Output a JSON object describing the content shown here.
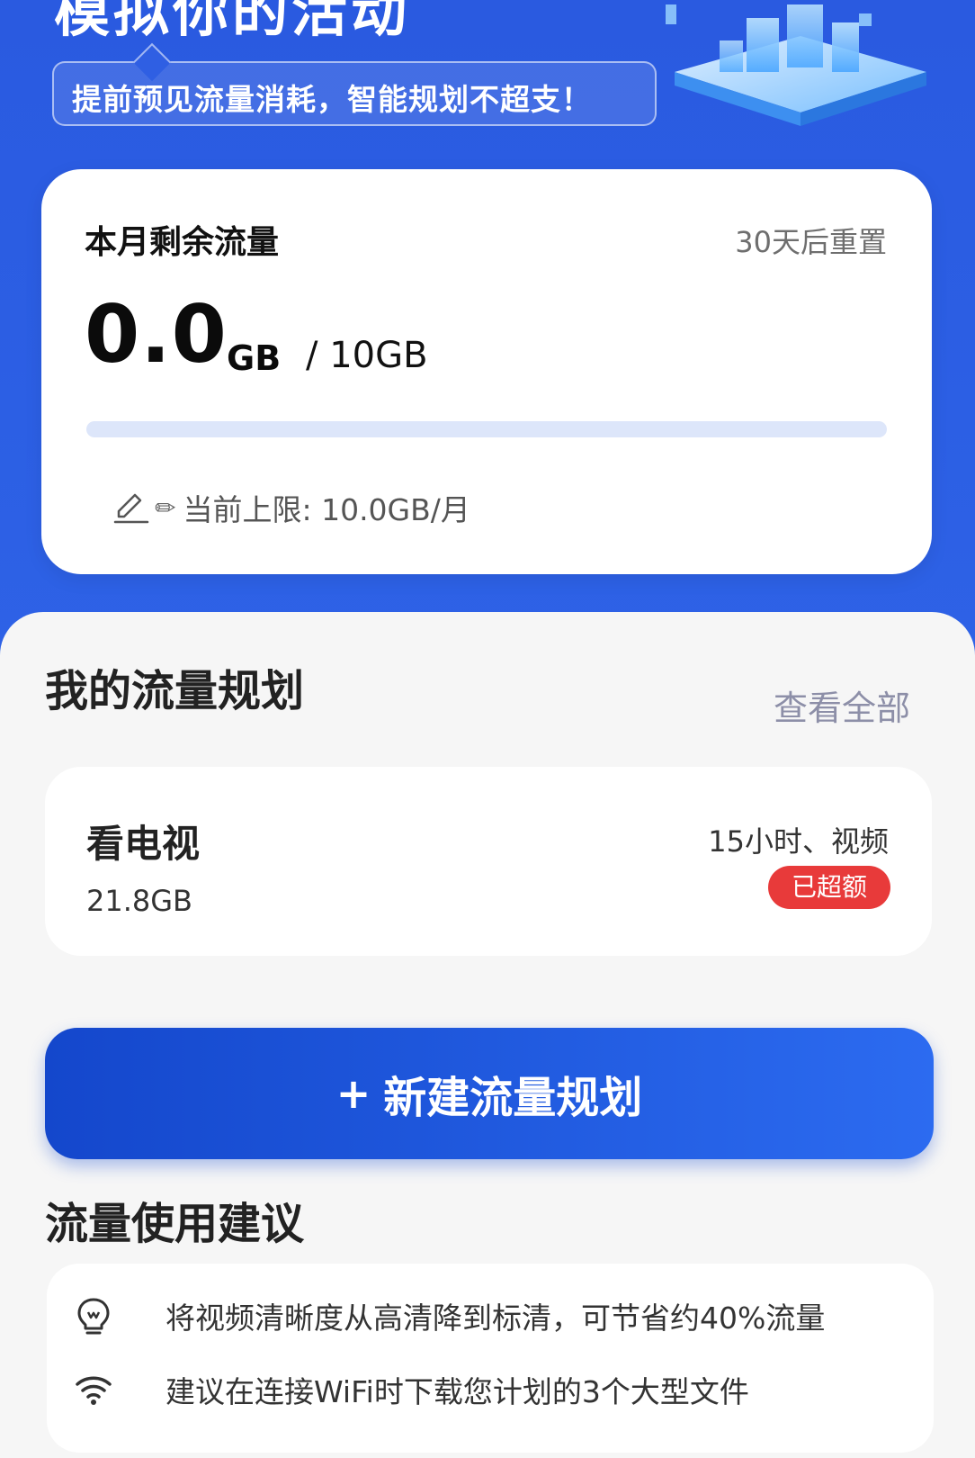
{
  "hero": {
    "title": "模拟你的活动",
    "subtitle": "提前预见流量消耗，智能规划不超支！"
  },
  "usage": {
    "title": "本月剩余流量",
    "reset": "30天后重置",
    "remaining_value": "0.0",
    "remaining_unit": "GB",
    "total": "/ 10GB",
    "progress_fraction": 0.0,
    "edit_glyph": "✏",
    "limit_text": "当前上限: 10.0GB/月"
  },
  "plans": {
    "title": "我的流量规划",
    "view_all": "查看全部",
    "items": [
      {
        "name": "看电视",
        "size": "21.8GB",
        "desc": "15小时、视频",
        "badge": "已超额"
      }
    ]
  },
  "new_plan": {
    "plus": "+",
    "label": "新建流量规划"
  },
  "tips": {
    "title": "流量使用建议",
    "items": [
      {
        "icon": "lightbulb-icon",
        "text": "将视频清晰度从高清降到标清，可节省约40%流量"
      },
      {
        "icon": "wifi-icon",
        "text": "建议在连接WiFi时下载您计划的3个大型文件"
      }
    ]
  },
  "colors": {
    "brand_blue": "#2c5fe4",
    "badge_red": "#e83a3a"
  }
}
